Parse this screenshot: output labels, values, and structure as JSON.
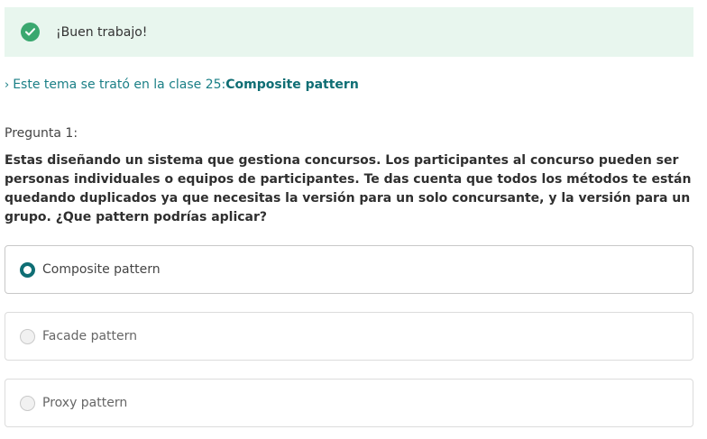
{
  "feedback": {
    "message": "¡Buen trabajo!",
    "icon": "check-circle-icon",
    "color": "#3aa86f"
  },
  "topic": {
    "prefix": "Este tema se trató en la clase 25:",
    "name": "Composite pattern"
  },
  "question": {
    "label": "Pregunta 1:",
    "text": "Estas diseñando un sistema que gestiona concursos. Los participantes al concurso pueden ser personas individuales o equipos de participantes. Te das cuenta que todos los métodos te están quedando duplicados ya que necesitas la versión para un solo concursante, y la versión para un grupo. ¿Que pattern podrías aplicar?"
  },
  "options": [
    {
      "label": "Composite pattern",
      "selected": true
    },
    {
      "label": "Facade pattern",
      "selected": false
    },
    {
      "label": "Proxy pattern",
      "selected": false
    }
  ],
  "accent_color": "#0f6e74"
}
